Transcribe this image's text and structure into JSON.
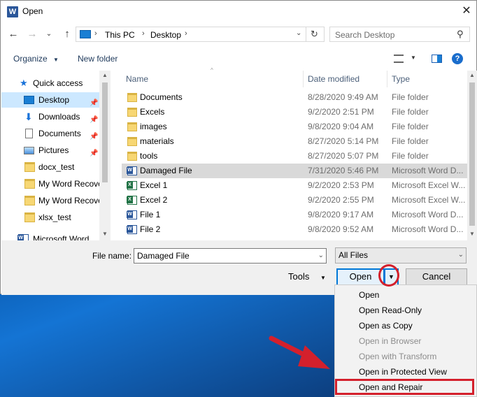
{
  "window": {
    "title": "Open",
    "app_icon": "word-icon"
  },
  "address": {
    "segments": [
      "This PC",
      "Desktop"
    ]
  },
  "search": {
    "placeholder": "Search Desktop"
  },
  "toolbar": {
    "organize": "Organize",
    "new_folder": "New folder"
  },
  "nav": {
    "items": [
      {
        "label": "Quick access",
        "icon": "star-icon"
      },
      {
        "label": "Desktop",
        "icon": "desktop-icon",
        "selected": true,
        "pinned": true
      },
      {
        "label": "Downloads",
        "icon": "download-icon",
        "pinned": true
      },
      {
        "label": "Documents",
        "icon": "documents-icon",
        "pinned": true
      },
      {
        "label": "Pictures",
        "icon": "pictures-icon",
        "pinned": true
      },
      {
        "label": "docx_test",
        "icon": "folder-icon"
      },
      {
        "label": "My Word Recove",
        "icon": "folder-icon"
      },
      {
        "label": "My Word Recove",
        "icon": "folder-icon"
      },
      {
        "label": "xlsx_test",
        "icon": "folder-icon"
      },
      {
        "label": "Microsoft Word",
        "icon": "word-icon"
      }
    ]
  },
  "columns": {
    "name": "Name",
    "date": "Date modified",
    "type": "Type"
  },
  "files": [
    {
      "name": "Documents",
      "date": "8/28/2020 9:49 AM",
      "type": "File folder",
      "kind": "folder"
    },
    {
      "name": "Excels",
      "date": "9/2/2020 2:51 PM",
      "type": "File folder",
      "kind": "folder"
    },
    {
      "name": "images",
      "date": "9/8/2020 9:04 AM",
      "type": "File folder",
      "kind": "folder"
    },
    {
      "name": "materials",
      "date": "8/27/2020 5:14 PM",
      "type": "File folder",
      "kind": "folder"
    },
    {
      "name": "tools",
      "date": "8/27/2020 5:07 PM",
      "type": "File folder",
      "kind": "folder"
    },
    {
      "name": "Damaged File",
      "date": "7/31/2020 5:46 PM",
      "type": "Microsoft Word D...",
      "kind": "word",
      "selected": true
    },
    {
      "name": "Excel 1",
      "date": "9/2/2020 2:53 PM",
      "type": "Microsoft Excel W...",
      "kind": "excel"
    },
    {
      "name": "Excel 2",
      "date": "9/2/2020 2:55 PM",
      "type": "Microsoft Excel W...",
      "kind": "excel"
    },
    {
      "name": "File 1",
      "date": "9/8/2020 9:17 AM",
      "type": "Microsoft Word D...",
      "kind": "word"
    },
    {
      "name": "File 2",
      "date": "9/8/2020 9:52 AM",
      "type": "Microsoft Word D...",
      "kind": "word"
    }
  ],
  "bottom": {
    "file_name_label": "File name:",
    "file_name_value": "Damaged File",
    "file_type": "All Files",
    "tools": "Tools",
    "open": "Open",
    "cancel": "Cancel"
  },
  "open_menu": {
    "items": [
      {
        "label": "Open",
        "enabled": true
      },
      {
        "label": "Open Read-Only",
        "enabled": true
      },
      {
        "label": "Open as Copy",
        "enabled": true
      },
      {
        "label": "Open in Browser",
        "enabled": false
      },
      {
        "label": "Open with Transform",
        "enabled": false
      },
      {
        "label": "Open in Protected View",
        "enabled": true
      },
      {
        "label": "Open and Repair",
        "enabled": true,
        "highlighted": true
      }
    ]
  },
  "annotation_color": "#d4202c"
}
